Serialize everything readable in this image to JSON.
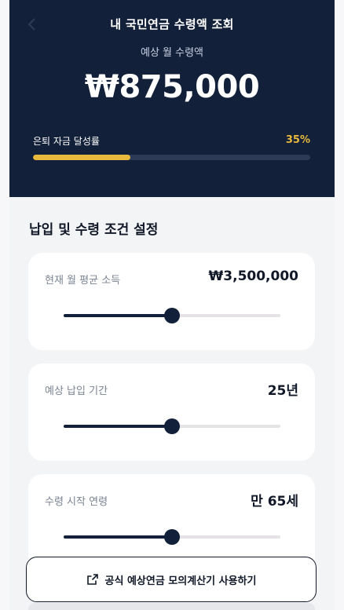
{
  "header": {
    "title": "내 국민연금 수령액 조회",
    "subtitle": "예상 월 수령액",
    "amount": "₩875,000",
    "goal_label": "은퇴 자금 달성률",
    "goal_percent_text": "35%",
    "goal_progress": 0.35
  },
  "section": {
    "title": "납입 및 수령 조건 설정"
  },
  "cards": [
    {
      "label": "현재 월 평균 소득",
      "value": "₩3,500,000",
      "slider_fraction": 0.5
    },
    {
      "label": "예상 납입 기간",
      "value": "25년",
      "slider_fraction": 0.5
    },
    {
      "label": "수령 시작 연령",
      "value": "만 65세",
      "slider_fraction": 0.5
    }
  ],
  "cta": {
    "label": "공식 예상연금 모의계산기 사용하기",
    "icon": "external-link-icon"
  },
  "colors": {
    "navy": "#13203a",
    "gold": "#e8b93c"
  }
}
